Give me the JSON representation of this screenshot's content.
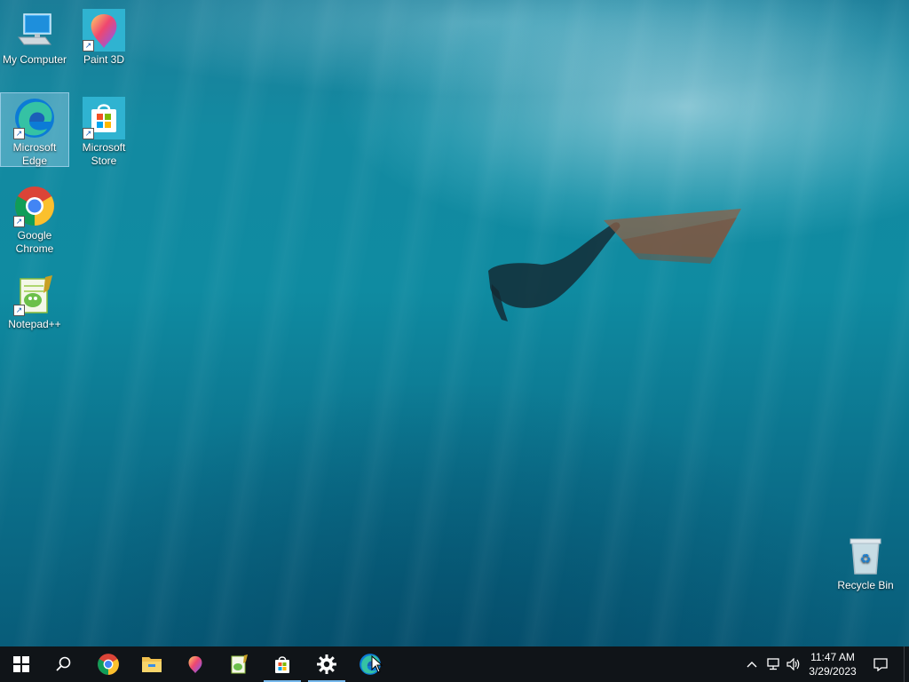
{
  "desktop": {
    "icons": [
      {
        "label": "My Computer",
        "icon": "computer-icon"
      },
      {
        "label": "Paint 3D",
        "icon": "paint-3d-icon"
      },
      {
        "label": "Microsoft Edge",
        "icon": "edge-icon",
        "selected": true
      },
      {
        "label": "Microsoft Store",
        "icon": "store-icon"
      },
      {
        "label": "Google Chrome",
        "icon": "chrome-icon"
      },
      {
        "label": "Notepad++",
        "icon": "notepad-plus-plus-icon"
      },
      {
        "label": "Recycle Bin",
        "icon": "recycle-bin-icon"
      }
    ]
  },
  "taskbar": {
    "buttons": [
      "start-icon",
      "search-icon",
      "chrome-icon",
      "file-explorer-icon",
      "paint-3d-icon",
      "notepad-plus-plus-icon",
      "store-icon",
      "settings-icon",
      "edge-icon"
    ],
    "tray": {
      "icons": [
        "chevron-up-icon",
        "network-icon",
        "volume-icon",
        "notification-icon"
      ],
      "time": "11:47 AM",
      "date": "3/29/2023"
    }
  },
  "colors": {
    "taskbar": "#101418",
    "accent": "#76b9ed"
  }
}
